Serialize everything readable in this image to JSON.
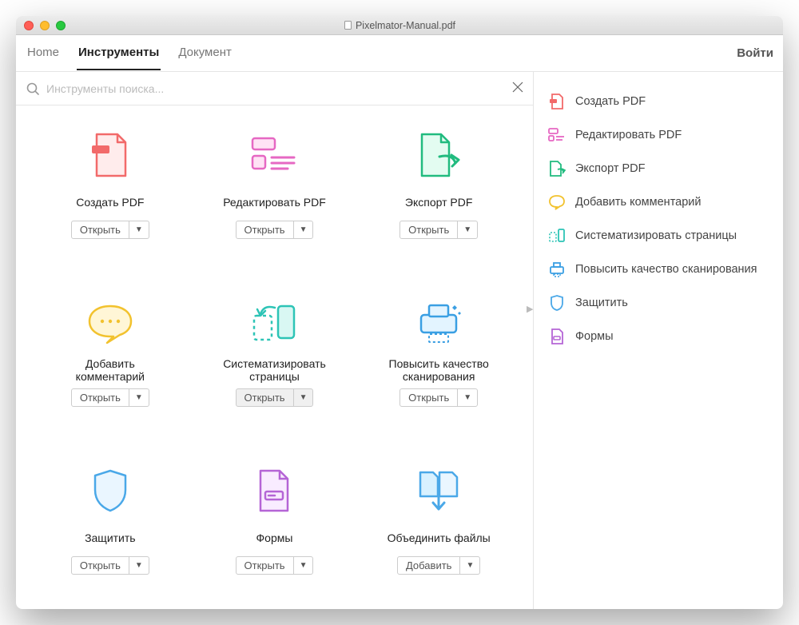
{
  "window": {
    "title": "Pixelmator-Manual.pdf"
  },
  "tabs": {
    "home": "Home",
    "tools": "Инструменты",
    "document": "Документ"
  },
  "login": "Войти",
  "search": {
    "placeholder": "Инструменты поиска..."
  },
  "buttons": {
    "open": "Открыть",
    "add": "Добавить"
  },
  "tools": {
    "create": "Создать PDF",
    "edit": "Редактировать PDF",
    "export": "Экспорт PDF",
    "comment": "Добавить комментарий",
    "organize": "Систематизировать страницы",
    "scan": "Повысить качество сканирования",
    "protect": "Защитить",
    "forms": "Формы",
    "combine": "Объединить файлы"
  },
  "sidebar": {
    "create": "Создать PDF",
    "edit": "Редактировать PDF",
    "export": "Экспорт PDF",
    "comment": "Добавить комментарий",
    "organize": "Систематизировать страницы",
    "scan": "Повысить качество сканирования",
    "protect": "Защитить",
    "forms": "Формы"
  }
}
